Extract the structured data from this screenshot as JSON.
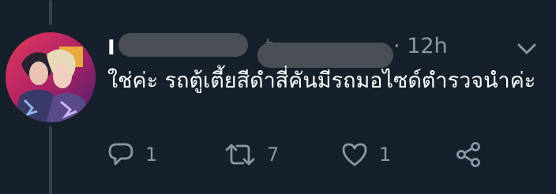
{
  "tweet": {
    "display_name_visible": "I",
    "handle_visible": "t",
    "time_separator": "·",
    "timestamp": "12h",
    "text": "ใช่ค่ะ รถตู้เตี้ยสีดำสี่คันมีรถมอไซด์ตำรวจนำค่ะ",
    "reply_count": "1",
    "retweet_count": "7",
    "like_count": "1"
  },
  "icons": {
    "menu": "chevron-down-icon",
    "reply": "reply-icon",
    "retweet": "retweet-icon",
    "like": "heart-icon",
    "share": "share-icon"
  },
  "colors": {
    "background": "#15202b",
    "text_primary": "#ffffff",
    "text_secondary": "#8899a6",
    "thread_line": "#38444d",
    "redaction": "#4a4e55"
  }
}
